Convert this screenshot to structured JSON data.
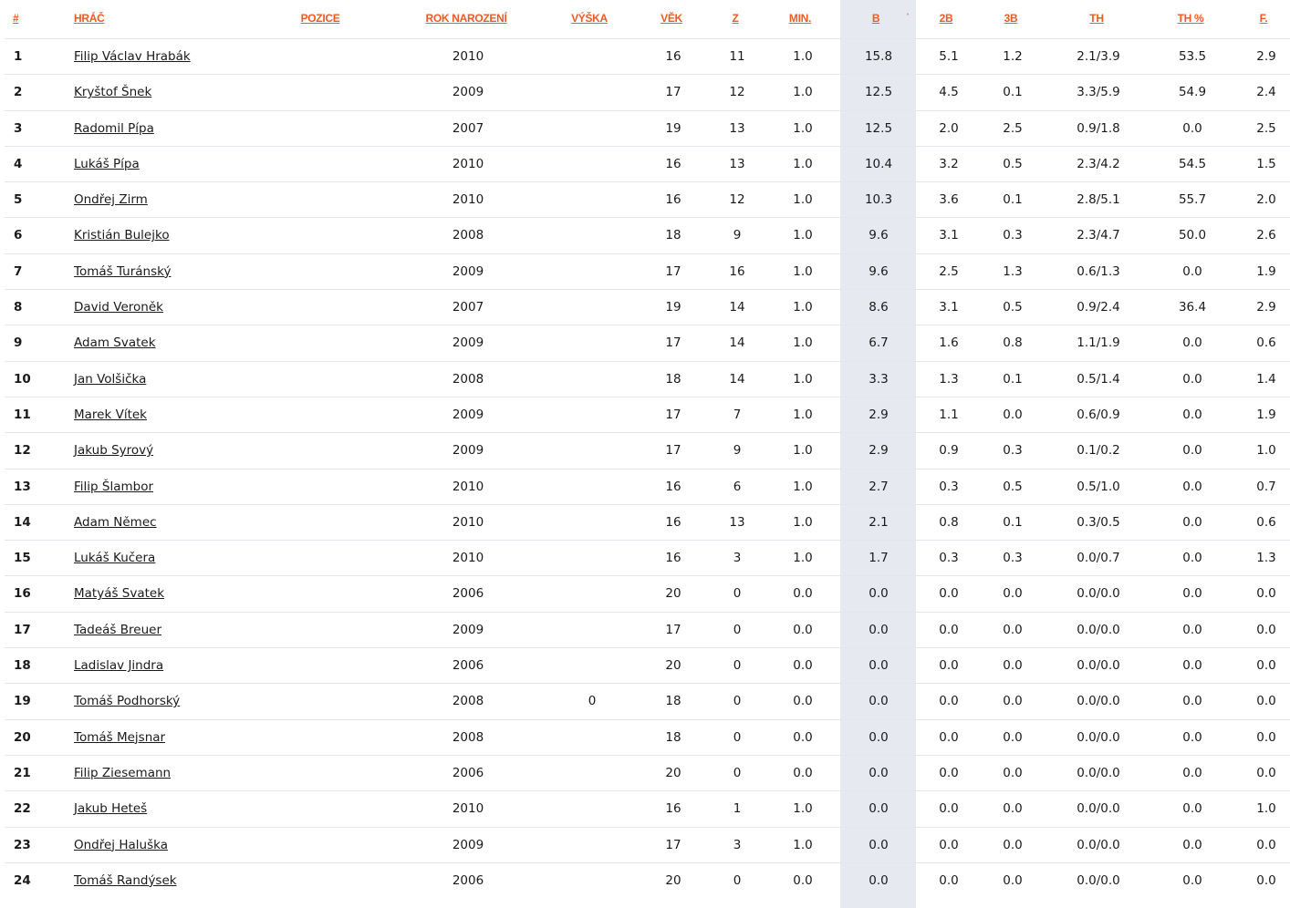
{
  "columns": [
    {
      "key": "rank",
      "label": "#"
    },
    {
      "key": "player",
      "label": "HRÁČ"
    },
    {
      "key": "position",
      "label": "POZICE"
    },
    {
      "key": "birth_year",
      "label": "ROK NAROZENÍ"
    },
    {
      "key": "height",
      "label": "VÝŠKA"
    },
    {
      "key": "age",
      "label": "VĚK"
    },
    {
      "key": "games",
      "label": "Z"
    },
    {
      "key": "minutes",
      "label": "MIN."
    },
    {
      "key": "points",
      "label": "B"
    },
    {
      "key": "two_pt",
      "label": "2B"
    },
    {
      "key": "three_pt",
      "label": "3B"
    },
    {
      "key": "free_throws",
      "label": "TH"
    },
    {
      "key": "ft_pct",
      "label": "TH %"
    },
    {
      "key": "fouls",
      "label": "F."
    }
  ],
  "sort": {
    "column": "points",
    "indicator": "˄"
  },
  "rows": [
    [
      "1",
      "Filip Václav Hrabák",
      "",
      "2010",
      "",
      "16",
      "11",
      "1.0",
      "15.8",
      "5.1",
      "1.2",
      "2.1/3.9",
      "53.5",
      "2.9"
    ],
    [
      "2",
      "Kryštof Šnek",
      "",
      "2009",
      "",
      "17",
      "12",
      "1.0",
      "12.5",
      "4.5",
      "0.1",
      "3.3/5.9",
      "54.9",
      "2.4"
    ],
    [
      "3",
      "Radomil Pípa",
      "",
      "2007",
      "",
      "19",
      "13",
      "1.0",
      "12.5",
      "2.0",
      "2.5",
      "0.9/1.8",
      "0.0",
      "2.5"
    ],
    [
      "4",
      "Lukáš Pípa",
      "",
      "2010",
      "",
      "16",
      "13",
      "1.0",
      "10.4",
      "3.2",
      "0.5",
      "2.3/4.2",
      "54.5",
      "1.5"
    ],
    [
      "5",
      "Ondřej Zirm",
      "",
      "2010",
      "",
      "16",
      "12",
      "1.0",
      "10.3",
      "3.6",
      "0.1",
      "2.8/5.1",
      "55.7",
      "2.0"
    ],
    [
      "6",
      "Kristián Bulejko",
      "",
      "2008",
      "",
      "18",
      "9",
      "1.0",
      "9.6",
      "3.1",
      "0.3",
      "2.3/4.7",
      "50.0",
      "2.6"
    ],
    [
      "7",
      "Tomáš Turánský",
      "",
      "2009",
      "",
      "17",
      "16",
      "1.0",
      "9.6",
      "2.5",
      "1.3",
      "0.6/1.3",
      "0.0",
      "1.9"
    ],
    [
      "8",
      "David Veroněk",
      "",
      "2007",
      "",
      "19",
      "14",
      "1.0",
      "8.6",
      "3.1",
      "0.5",
      "0.9/2.4",
      "36.4",
      "2.9"
    ],
    [
      "9",
      "Adam Svatek",
      "",
      "2009",
      "",
      "17",
      "14",
      "1.0",
      "6.7",
      "1.6",
      "0.8",
      "1.1/1.9",
      "0.0",
      "0.6"
    ],
    [
      "10",
      "Jan Volšička",
      "",
      "2008",
      "",
      "18",
      "14",
      "1.0",
      "3.3",
      "1.3",
      "0.1",
      "0.5/1.4",
      "0.0",
      "1.4"
    ],
    [
      "11",
      "Marek Vítek",
      "",
      "2009",
      "",
      "17",
      "7",
      "1.0",
      "2.9",
      "1.1",
      "0.0",
      "0.6/0.9",
      "0.0",
      "1.9"
    ],
    [
      "12",
      "Jakub Syrový",
      "",
      "2009",
      "",
      "17",
      "9",
      "1.0",
      "2.9",
      "0.9",
      "0.3",
      "0.1/0.2",
      "0.0",
      "1.0"
    ],
    [
      "13",
      "Filip Šlambor",
      "",
      "2010",
      "",
      "16",
      "6",
      "1.0",
      "2.7",
      "0.3",
      "0.5",
      "0.5/1.0",
      "0.0",
      "0.7"
    ],
    [
      "14",
      "Adam Němec",
      "",
      "2010",
      "",
      "16",
      "13",
      "1.0",
      "2.1",
      "0.8",
      "0.1",
      "0.3/0.5",
      "0.0",
      "0.6"
    ],
    [
      "15",
      "Lukáš Kučera",
      "",
      "2010",
      "",
      "16",
      "3",
      "1.0",
      "1.7",
      "0.3",
      "0.3",
      "0.0/0.7",
      "0.0",
      "1.3"
    ],
    [
      "16",
      "Matyáš Svatek",
      "",
      "2006",
      "",
      "20",
      "0",
      "0.0",
      "0.0",
      "0.0",
      "0.0",
      "0.0/0.0",
      "0.0",
      "0.0"
    ],
    [
      "17",
      "Tadeáš Breuer",
      "",
      "2009",
      "",
      "17",
      "0",
      "0.0",
      "0.0",
      "0.0",
      "0.0",
      "0.0/0.0",
      "0.0",
      "0.0"
    ],
    [
      "18",
      "Ladislav Jindra",
      "",
      "2006",
      "",
      "20",
      "0",
      "0.0",
      "0.0",
      "0.0",
      "0.0",
      "0.0/0.0",
      "0.0",
      "0.0"
    ],
    [
      "19",
      "Tomáš Podhorský",
      "",
      "2008",
      "0",
      "18",
      "0",
      "0.0",
      "0.0",
      "0.0",
      "0.0",
      "0.0/0.0",
      "0.0",
      "0.0"
    ],
    [
      "20",
      "Tomáš Mejsnar",
      "",
      "2008",
      "",
      "18",
      "0",
      "0.0",
      "0.0",
      "0.0",
      "0.0",
      "0.0/0.0",
      "0.0",
      "0.0"
    ],
    [
      "21",
      "Filip Ziesemann",
      "",
      "2006",
      "",
      "20",
      "0",
      "0.0",
      "0.0",
      "0.0",
      "0.0",
      "0.0/0.0",
      "0.0",
      "0.0"
    ],
    [
      "22",
      "Jakub Heteš",
      "",
      "2010",
      "",
      "16",
      "1",
      "1.0",
      "0.0",
      "0.0",
      "0.0",
      "0.0/0.0",
      "0.0",
      "1.0"
    ],
    [
      "23",
      "Ondřej Haluška",
      "",
      "2009",
      "",
      "17",
      "3",
      "1.0",
      "0.0",
      "0.0",
      "0.0",
      "0.0/0.0",
      "0.0",
      "0.0"
    ],
    [
      "24",
      "Tomáš Randýsek",
      "",
      "2006",
      "",
      "20",
      "0",
      "0.0",
      "0.0",
      "0.0",
      "0.0",
      "0.0/0.0",
      "0.0",
      "0.0"
    ]
  ],
  "colors": {
    "accent": "#ee5a24",
    "sorted_column_bg": "#e7e9f1",
    "row_divider": "#e4e6ed"
  }
}
